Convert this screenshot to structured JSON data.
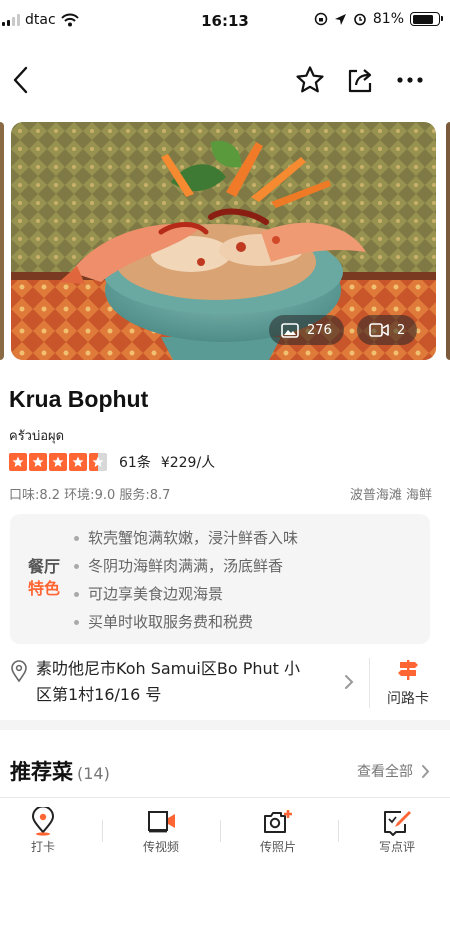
{
  "status_bar": {
    "carrier": "dtac",
    "time": "16:13",
    "battery_percent": "81%",
    "battery_level": 0.81
  },
  "nav": {
    "icons": [
      "back-arrow-icon",
      "star-outline-icon",
      "share-icon",
      "more-dots-icon"
    ]
  },
  "photos": {
    "photo_count": "276",
    "video_count": "2"
  },
  "restaurant": {
    "name": "Krua Bophut",
    "thai_name": "ครัวบ่อผุด",
    "rating": 4.5,
    "review_count": "61条",
    "price": "¥229/人",
    "scores": "口味:8.2 环境:9.0 服务:8.7",
    "tags": "波普海滩 海鲜"
  },
  "features": {
    "label_line1": "餐厅",
    "label_line2": "特色",
    "items": [
      "软壳蟹饱满软嫩，浸汁鲜香入味",
      "冬阴功海鲜肉满满，汤底鲜香",
      "可边享美食边观海景",
      "买单时收取服务费和税费"
    ]
  },
  "address": {
    "text": "素叻他尼市Koh Samui区Bo Phut 小区第1村16/16 号",
    "guide_card_label": "问路卡"
  },
  "recommended": {
    "title": "推荐菜",
    "count": "(14)",
    "see_all": "查看全部"
  },
  "action_bar": {
    "items": [
      {
        "label": "打卡",
        "icon": "location-pin-icon"
      },
      {
        "label": "传视频",
        "icon": "upload-video-icon"
      },
      {
        "label": "传照片",
        "icon": "upload-photo-icon"
      },
      {
        "label": "写点评",
        "icon": "write-review-icon"
      }
    ]
  },
  "colors": {
    "accent": "#ff6633",
    "muted_text": "#777777",
    "feature_bg": "#f5f5f5"
  }
}
